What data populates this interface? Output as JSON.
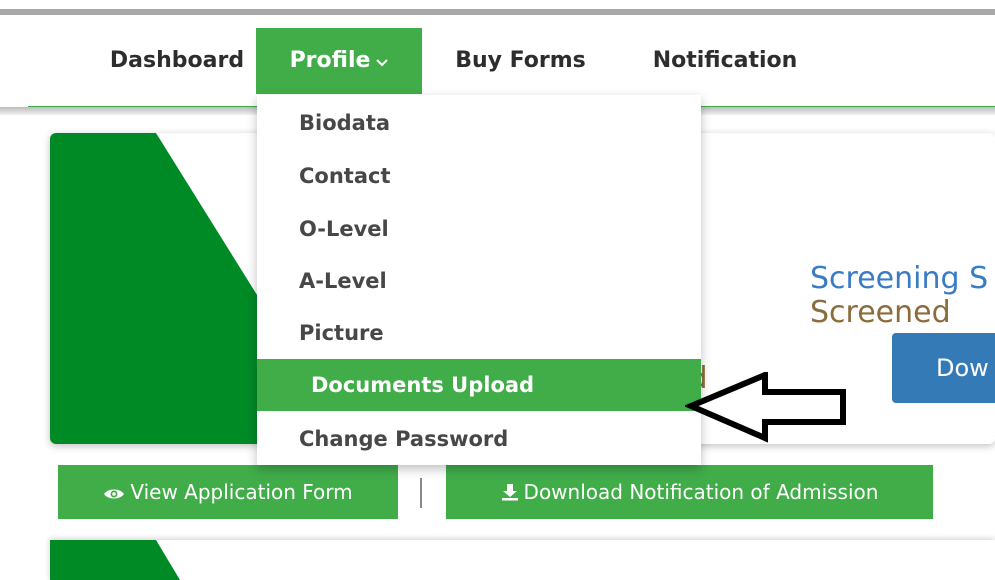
{
  "nav": {
    "items": [
      {
        "label": "Dashboard"
      },
      {
        "label": "Profile"
      },
      {
        "label": "Buy Forms"
      },
      {
        "label": "Notification"
      }
    ]
  },
  "profile_menu": {
    "items": [
      {
        "label": "Biodata"
      },
      {
        "label": "Contact"
      },
      {
        "label": "O-Level"
      },
      {
        "label": "A-Level"
      },
      {
        "label": "Picture"
      },
      {
        "label": "Documents Upload"
      },
      {
        "label": "Change Password"
      }
    ],
    "highlighted": "Documents Upload"
  },
  "card": {
    "screening_label": "Screening S",
    "screening_value": "Screened",
    "download_button": "Dow",
    "partial_text": "ed"
  },
  "actions": {
    "view_form": "View Application Form",
    "download_admission": "Download Notification of Admission"
  },
  "colors": {
    "accent_green": "#40ad49",
    "dark_green": "#008a26",
    "link_blue": "#3a7cc4",
    "status_brown": "#8a6d3b",
    "button_blue": "#337ab7"
  }
}
